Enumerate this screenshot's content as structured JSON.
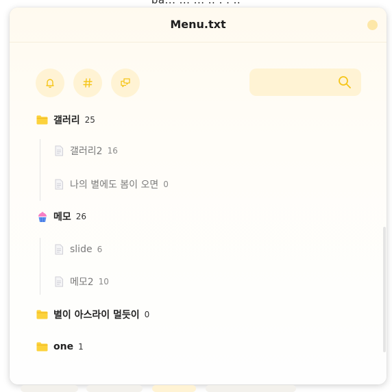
{
  "top_peek_text": "ba... ... ... .. . . ..",
  "window": {
    "title": "Menu.txt"
  },
  "toolbar": {
    "buttons": [
      {
        "icon": "bell-icon"
      },
      {
        "icon": "hash-icon"
      },
      {
        "icon": "chat-bubbles-icon"
      }
    ]
  },
  "search": {
    "value": "",
    "placeholder": "",
    "icon": "search-icon"
  },
  "tree": {
    "folders": [
      {
        "label": "갤러리",
        "count": "25",
        "icon": "folder-icon",
        "children": [
          {
            "label": "갤러리2",
            "count": "16",
            "icon": "document-icon"
          },
          {
            "label": "나의 별에도 봄이 오면",
            "count": "0",
            "icon": "document-icon"
          }
        ]
      },
      {
        "label": "메모",
        "count": "26",
        "icon": "cupcake-icon",
        "children": [
          {
            "label": "slide",
            "count": "6",
            "icon": "document-icon"
          },
          {
            "label": "메모2",
            "count": "10",
            "icon": "document-icon"
          }
        ]
      },
      {
        "label": "별이 아스라이 멀듯이",
        "count": "0",
        "icon": "folder-icon",
        "children": []
      },
      {
        "label": "one",
        "count": "1",
        "icon": "folder-icon",
        "children": []
      }
    ]
  },
  "colors": {
    "accent": "#f5c518",
    "button_bg": "#fff3d4",
    "folder": "#fcd23c"
  }
}
